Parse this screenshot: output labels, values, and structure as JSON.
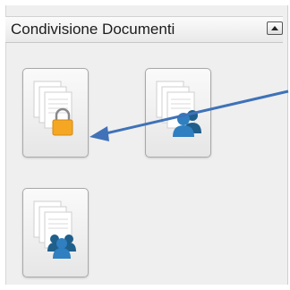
{
  "panel": {
    "title": "Condivisione Documenti"
  },
  "tiles": [
    {
      "icon": "document-lock-icon"
    },
    {
      "icon": "document-users-icon"
    },
    {
      "icon": "document-group-icon"
    }
  ],
  "colors": {
    "lock": "#f5a623",
    "users": "#2f7fc1",
    "group": "#1f5f8b",
    "arrow": "#3f72b8"
  }
}
